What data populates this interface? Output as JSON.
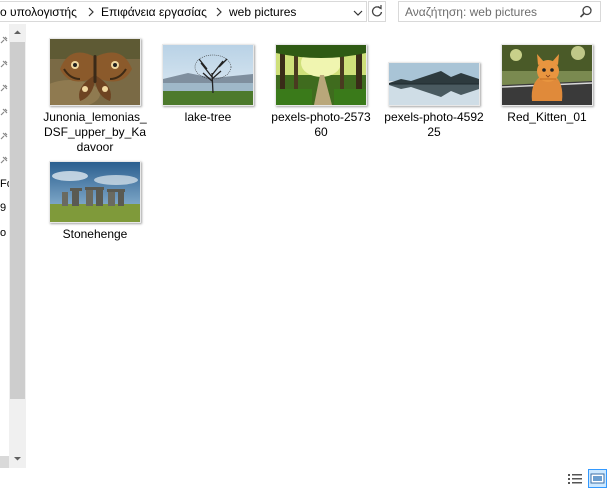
{
  "address_bar": {
    "breadcrumbs": [
      "ο υπολογιστής",
      "Επιφάνεια εργασίας",
      "web pictures"
    ]
  },
  "search": {
    "placeholder": "Αναζήτηση: web pictures"
  },
  "nav_fragments": [
    "Fo",
    "9",
    "o"
  ],
  "files": [
    {
      "name": "Junonia_lemonias_DSF_upper_by_Kadavoor",
      "thumb": "butterfly"
    },
    {
      "name": "lake-tree",
      "thumb": "lake-tree"
    },
    {
      "name": "pexels-photo-257360",
      "thumb": "forest-path"
    },
    {
      "name": "pexels-photo-459225",
      "thumb": "mountain-lake"
    },
    {
      "name": "Red_Kitten_01",
      "thumb": "kitten"
    },
    {
      "name": "Stonehenge",
      "thumb": "stonehenge"
    }
  ],
  "icons": {
    "breadcrumb_separator": "chevron-right-icon",
    "address_dropdown": "chevron-down-icon",
    "refresh": "refresh-icon",
    "search": "search-icon",
    "pin": "pin-icon",
    "view_details": "details-view-icon",
    "view_large": "large-icons-view-icon"
  },
  "colors": {
    "border": "#d9d9d9",
    "scrollbar_track": "#f0f0f0",
    "scrollbar_thumb": "#cdcdcd",
    "selected_view": "#cce8ff",
    "selected_view_border": "#3399ff"
  }
}
